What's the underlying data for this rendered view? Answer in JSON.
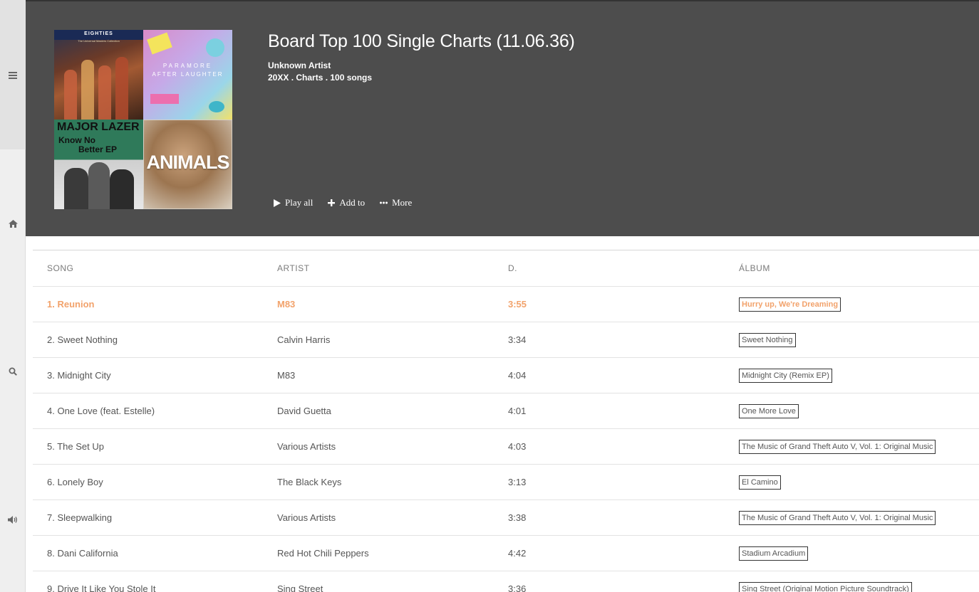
{
  "sidebar": {
    "icons": [
      "menu-icon",
      "home-icon",
      "search-icon",
      "volume-icon"
    ]
  },
  "header": {
    "title": "Board Top 100 Single Charts (11.06.36)",
    "artist": "Unknown Artist",
    "meta": "20XX . Charts . 100 songs",
    "actions": {
      "play_all": "Play all",
      "add_to": "Add to",
      "more": "More"
    },
    "covers": {
      "c1_top": "EIGHTIES",
      "c1_sub": "The Universal Masters Collection",
      "c2_line1": "PARAMORE",
      "c2_line2": "AFTER LAUGHTER",
      "c3_line1": "MAJOR LAZER",
      "c3_line2": "Know No",
      "c3_line3": "Better EP",
      "c4_line1": "ANIMALS"
    }
  },
  "table": {
    "headers": {
      "song": "SONG",
      "artist": "ARTIST",
      "duration": "D.",
      "album": "ÁLBUM"
    },
    "rows": [
      {
        "song": "1. Reunion",
        "artist": "M83",
        "duration": "3:55",
        "album": "Hurry up, We're Dreaming"
      },
      {
        "song": "2. Sweet Nothing",
        "artist": "Calvin Harris",
        "duration": "3:34",
        "album": "Sweet Nothing"
      },
      {
        "song": "3. Midnight City",
        "artist": "M83",
        "duration": "4:04",
        "album": "Midnight City (Remix EP)"
      },
      {
        "song": "4. One Love (feat. Estelle)",
        "artist": "David Guetta",
        "duration": "4:01",
        "album": "One More Love"
      },
      {
        "song": "5. The Set Up",
        "artist": "Various Artists",
        "duration": "4:03",
        "album": "The Music of Grand Theft Auto V, Vol. 1: Original Music"
      },
      {
        "song": "6. Lonely Boy",
        "artist": "The Black Keys",
        "duration": "3:13",
        "album": "El Camino"
      },
      {
        "song": "7. Sleepwalking",
        "artist": "Various Artists",
        "duration": "3:38",
        "album": "The Music of Grand Theft Auto V, Vol. 1: Original Music"
      },
      {
        "song": "8. Dani California",
        "artist": "Red Hot Chili Peppers",
        "duration": "4:42",
        "album": "Stadium Arcadium"
      },
      {
        "song": "9. Drive It Like You Stole It",
        "artist": "Sing Street",
        "duration": "3:36",
        "album": "Sing Street (Original Motion Picture Soundtrack)"
      }
    ]
  },
  "colors": {
    "header_bg": "#4d4d4d",
    "active_accent": "#f2a26b",
    "sidebar_bg": "#efefef"
  }
}
